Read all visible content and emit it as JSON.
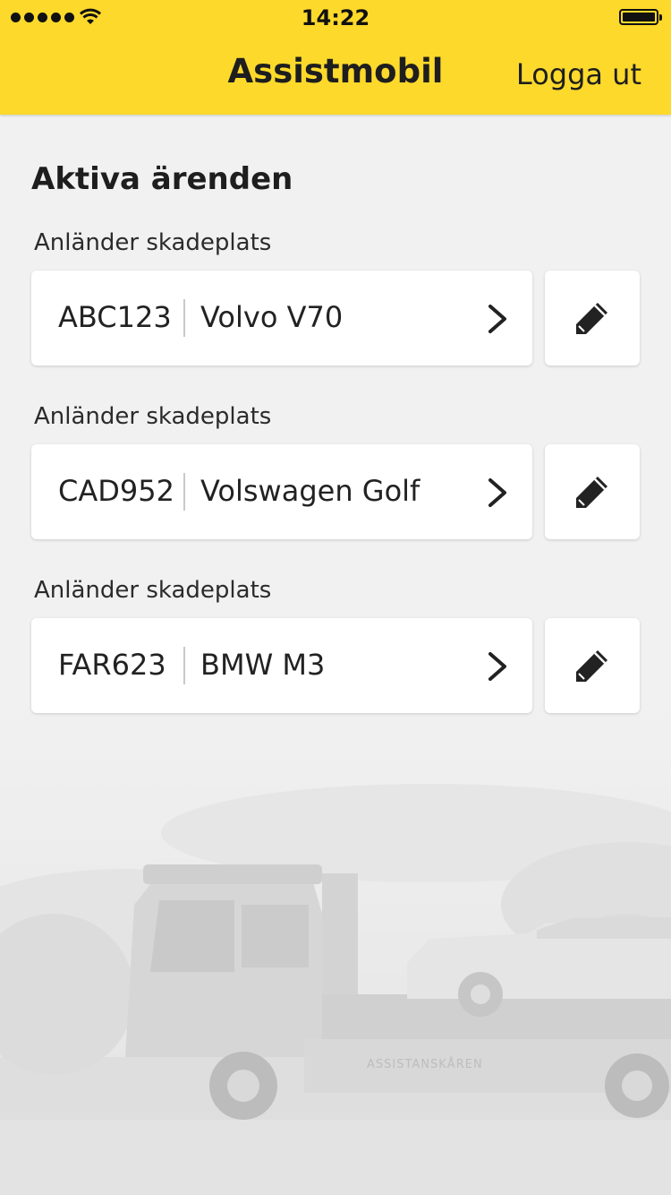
{
  "status_bar": {
    "time": "14:22"
  },
  "header": {
    "title": "Assistmobil",
    "logout_label": "Logga ut",
    "color": "#fdd92b"
  },
  "main": {
    "section_title": "Aktiva ärenden",
    "cases": [
      {
        "status": "Anländer skadeplats",
        "plate": "ABC123",
        "model": "Volvo V70"
      },
      {
        "status": "Anländer skadeplats",
        "plate": "CAD952",
        "model": "Volswagen Golf"
      },
      {
        "status": "Anländer skadeplats",
        "plate": "FAR623",
        "model": "BMW M3"
      }
    ]
  },
  "background": {
    "truck_lettering": "ASSISTANSKÅREN"
  },
  "icons": {
    "open": "chevron-right-icon",
    "edit": "pencil-icon"
  }
}
